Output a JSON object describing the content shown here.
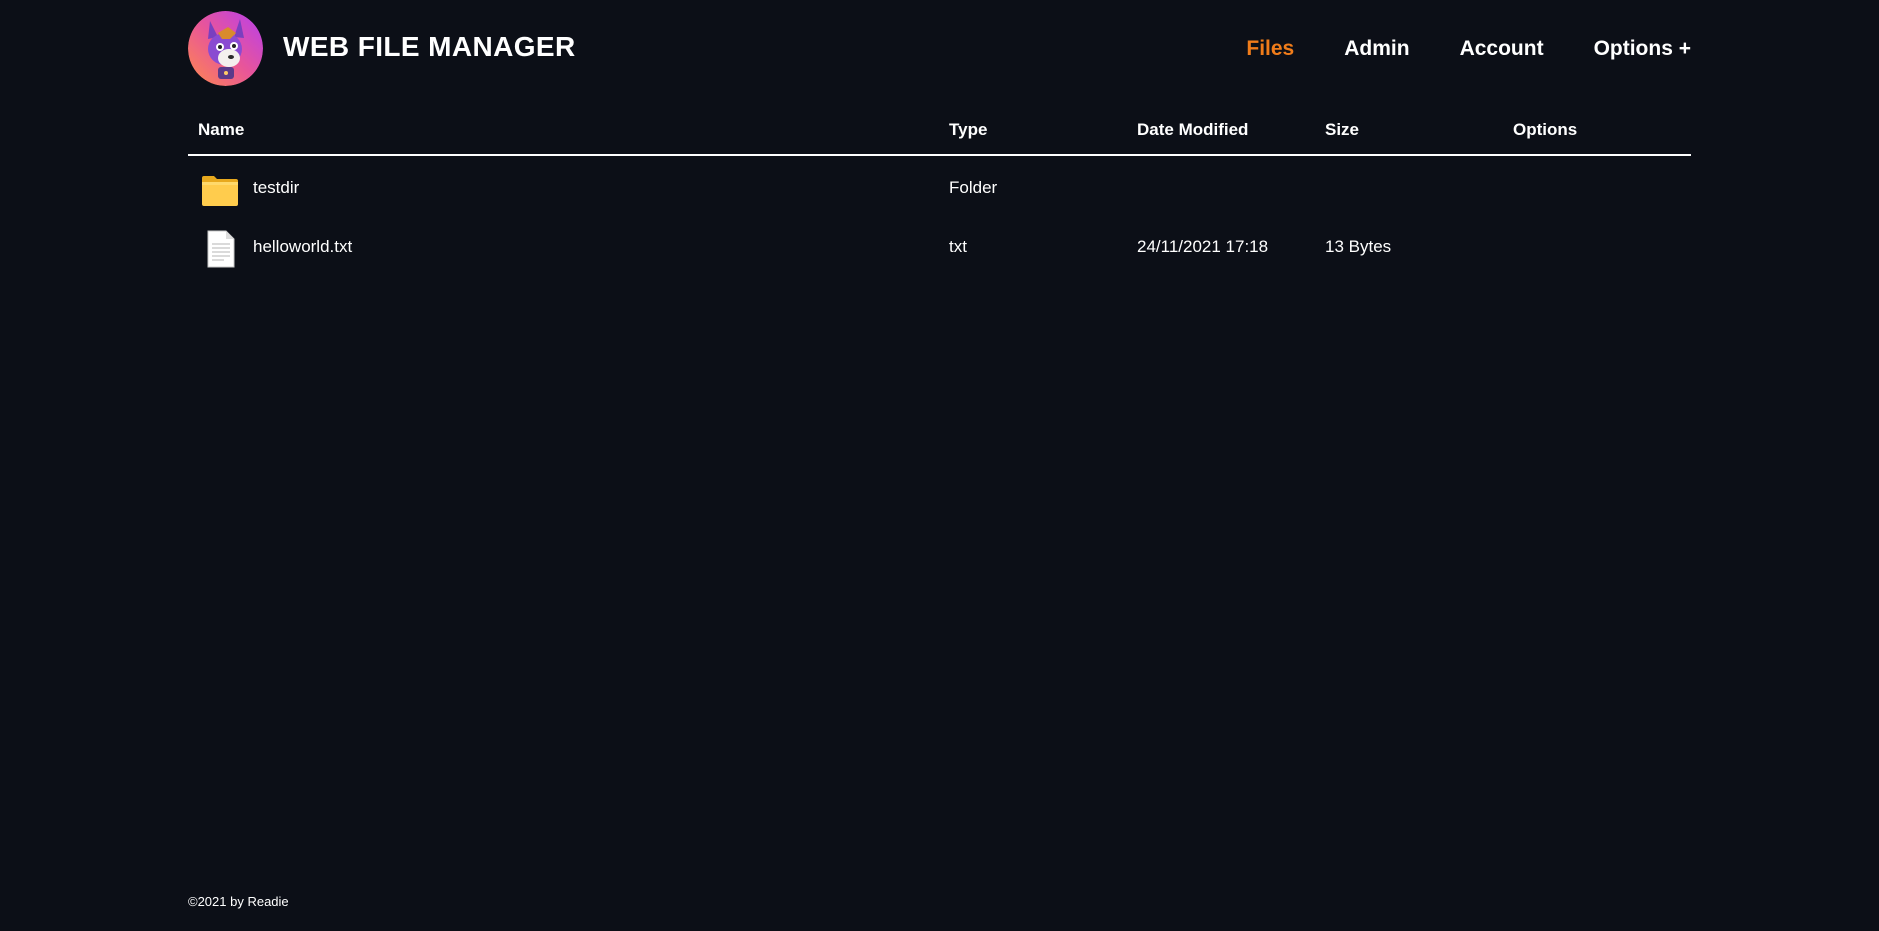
{
  "header": {
    "title": "WEB FILE MANAGER",
    "avatar_icon": "fox-avatar-icon",
    "nav": [
      {
        "label": "Files",
        "active": true
      },
      {
        "label": "Admin",
        "active": false
      },
      {
        "label": "Account",
        "active": false
      },
      {
        "label": "Options +",
        "active": false
      }
    ]
  },
  "table": {
    "columns": [
      "Name",
      "Type",
      "Date Modified",
      "Size",
      "Options"
    ],
    "rows": [
      {
        "icon": "folder-icon",
        "name": "testdir",
        "type": "Folder",
        "date": "",
        "size": ""
      },
      {
        "icon": "text-file-icon",
        "name": "helloworld.txt",
        "type": "txt",
        "date": "24/11/2021 17:18",
        "size": "13 Bytes"
      }
    ]
  },
  "footer": {
    "text": "©2021 by Readie"
  },
  "colors": {
    "background": "#0c0f17",
    "accent": "#f07c1a",
    "text": "#ffffff"
  }
}
